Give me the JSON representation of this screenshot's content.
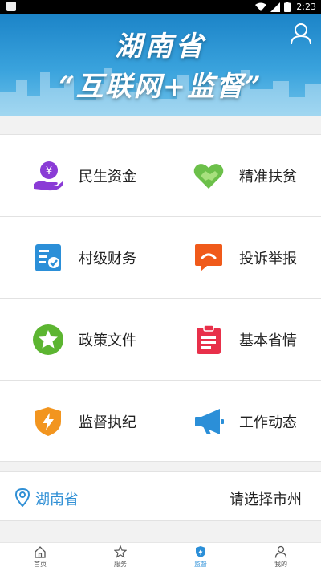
{
  "status_bar": {
    "time": "2:23",
    "icons": [
      "wifi-icon",
      "signal-icon",
      "battery-icon"
    ]
  },
  "banner": {
    "line1": "湖南省",
    "line2": "“互联网+监督”",
    "colors": {
      "top": "#1c84c8",
      "bottom": "#6fc2ea"
    }
  },
  "grid": {
    "items": [
      {
        "label": "民生资金",
        "icon": "money-hand-icon",
        "color": "#8a3bd6"
      },
      {
        "label": "精准扶贫",
        "icon": "heart-handshake-icon",
        "color": "#6cc04a"
      },
      {
        "label": "村级财务",
        "icon": "ledger-check-icon",
        "color": "#2b8fd8"
      },
      {
        "label": "投诉举报",
        "icon": "complaint-chat-icon",
        "color": "#f05a1a"
      },
      {
        "label": "政策文件",
        "icon": "star-badge-icon",
        "color": "#5cb531"
      },
      {
        "label": "基本省情",
        "icon": "clipboard-icon",
        "color": "#e8304a"
      },
      {
        "label": "监督执纪",
        "icon": "shield-bolt-icon",
        "color": "#f2951f"
      },
      {
        "label": "工作动态",
        "icon": "megaphone-icon",
        "color": "#2b8fd8"
      }
    ]
  },
  "location": {
    "province": "湖南省",
    "select_city": "请选择市州",
    "accent": "#2f8fd5"
  },
  "bottom_nav": {
    "tabs": [
      {
        "label": "首页",
        "icon": "home-icon"
      },
      {
        "label": "服务",
        "icon": "star-icon"
      },
      {
        "label": "监督",
        "icon": "shield-icon",
        "active": true
      },
      {
        "label": "我的",
        "icon": "person-icon"
      }
    ]
  }
}
